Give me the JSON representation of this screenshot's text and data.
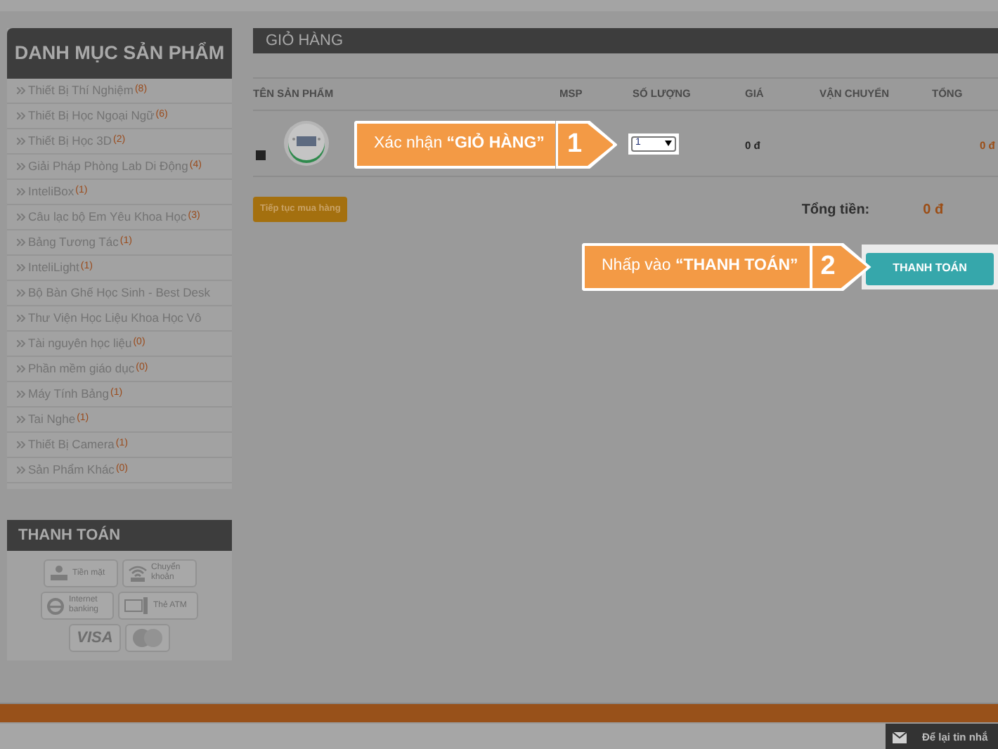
{
  "sidebar": {
    "title": "DANH MỤC SẢN PHẨM",
    "categories": [
      {
        "name": "Thiết Bị Thí Nghiệm",
        "count": "(8)"
      },
      {
        "name": "Thiết Bị Học Ngoại Ngữ",
        "count": "(6)"
      },
      {
        "name": "Thiết Bị Học 3D",
        "count": "(2)"
      },
      {
        "name": "Giải Pháp Phòng Lab Di Động",
        "count": "(4)"
      },
      {
        "name": "InteliBox",
        "count": "(1)"
      },
      {
        "name": "Câu lạc bộ Em Yêu Khoa Học",
        "count": "(3)"
      },
      {
        "name": "Bảng Tương Tác",
        "count": "(1)"
      },
      {
        "name": "InteliLight",
        "count": "(1)"
      },
      {
        "name": "Bộ Bàn Ghế Học Sinh - Best Desk"
      },
      {
        "name": "Thư Viện Học Liệu Khoa Học Vô"
      },
      {
        "name": "Tài nguyên học liệu",
        "count": "(0)"
      },
      {
        "name": "Phần mềm giáo dục",
        "count": "(0)"
      },
      {
        "name": "Máy Tính Bảng",
        "count": "(1)"
      },
      {
        "name": "Tai Nghe",
        "count": "(1)"
      },
      {
        "name": "Thiết Bị Camera",
        "count": "(1)"
      },
      {
        "name": "Sản Phẩm Khác",
        "count": "(0)"
      }
    ]
  },
  "payment": {
    "title": "THANH TOÁN",
    "methods": [
      {
        "kind": "cash",
        "label": "Tiền mặt"
      },
      {
        "kind": "transfer",
        "label": "Chuyển khoản"
      },
      {
        "kind": "ebank",
        "label": "Internet banking"
      },
      {
        "kind": "atm",
        "label": "Thẻ ATM"
      },
      {
        "kind": "visa",
        "label": "VISA"
      },
      {
        "kind": "mastercard"
      }
    ]
  },
  "cart": {
    "title": "GIỎ HÀNG",
    "columns": [
      "TÊN SẢN PHẨM",
      "MSP",
      "SỐ LƯỢNG",
      "GIÁ",
      "VẬN CHUYỂN",
      "TỔNG"
    ],
    "rows": [
      {
        "quantity": "1",
        "price": "0 đ",
        "total": "0 đ"
      }
    ],
    "continue_button": "Tiếp tục mua hàng",
    "total_label": "Tổng tiền:",
    "total": "0 đ",
    "checkout_button": "THANH TOÁN"
  },
  "callouts": [
    {
      "text": "Xác nhận **“GIỎ HÀNG”**",
      "number": "1"
    },
    {
      "text": "Nhấp vào **“THANH TOÁN”**",
      "number": "2"
    }
  ],
  "chat": {
    "label": "Để lại tin nhắ"
  }
}
